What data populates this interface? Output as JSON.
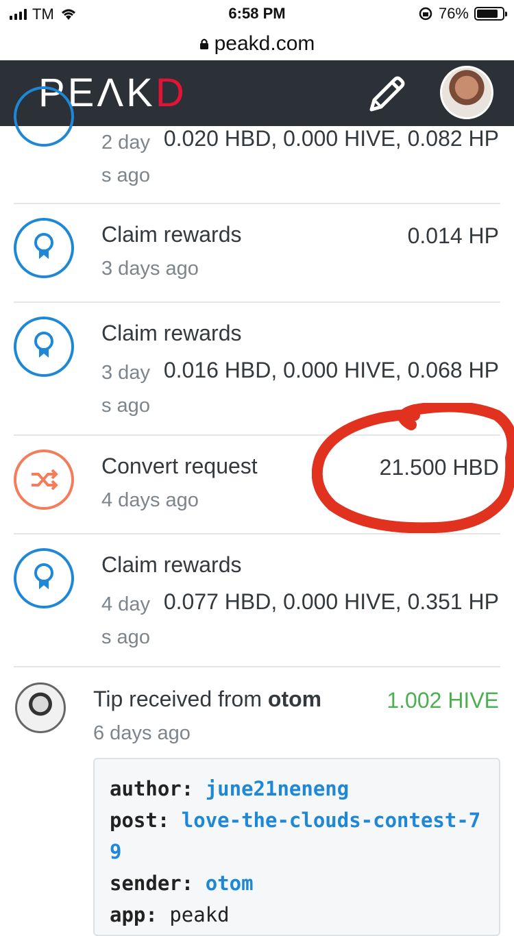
{
  "status_bar": {
    "carrier": "TM",
    "time": "6:58 PM",
    "battery": "76%",
    "battery_level": 0.76
  },
  "url": "peakd.com",
  "brand": {
    "logo_text": "PEAKD",
    "accent": "#e31337"
  },
  "items": [
    {
      "title": "",
      "time": "2 days ago",
      "amount": "0.020 HBD, 0.000 HIVE, 0.082 HP",
      "icon": "award-icon"
    },
    {
      "title": "Claim rewards",
      "time": "3 days ago",
      "amount": "0.014 HP",
      "icon": "award-icon"
    },
    {
      "title": "Claim rewards",
      "time": "3 days ago",
      "amount": "0.016 HBD, 0.000 HIVE, 0.068 HP",
      "icon": "award-icon"
    },
    {
      "title": "Convert request",
      "time": "4 days ago",
      "amount": "21.500 HBD",
      "icon": "shuffle-icon"
    },
    {
      "title": "Claim rewards",
      "time": "4 days ago",
      "amount": "0.077 HBD, 0.000 HIVE, 0.351 HP",
      "icon": "award-icon"
    }
  ],
  "tip": {
    "title_prefix": "Tip received from",
    "sender": "otom",
    "time": "6 days ago",
    "amount": "1.002 HIVE",
    "details": {
      "author_key": "author:",
      "author": "june21neneng",
      "post_key": "post:",
      "post": "love-the-clouds-contest-79",
      "sender_key": "sender:",
      "sender": "otom",
      "app_key": "app:",
      "app": "peakd"
    }
  },
  "colors": {
    "primary_blue": "#1e87d6",
    "convert_orange": "#f47c5a",
    "hive_green": "#4caf50",
    "annotation_red": "#e0321e"
  }
}
